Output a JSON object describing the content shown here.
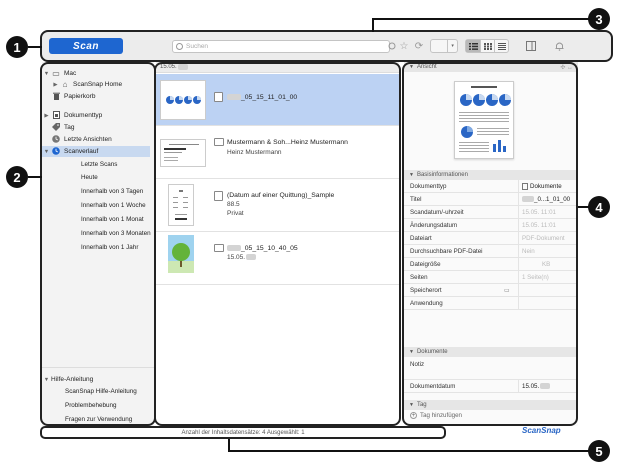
{
  "toolbar": {
    "scan_label": "Scan",
    "search_placeholder": "Suchen"
  },
  "sidebar": {
    "tree": [
      {
        "label": "Mac",
        "twisty": "▼",
        "icon": "▭"
      },
      {
        "label": "ScanSnap Home",
        "twisty": "▶",
        "icon": "⌂"
      },
      {
        "label": "Papierkorb",
        "twisty": "",
        "icon": "🗑"
      },
      {
        "label": "Dokumenttyp",
        "twisty": "▶",
        "icon": "▤"
      },
      {
        "label": "Tag",
        "twisty": "",
        "icon": "◆"
      },
      {
        "label": "Letzte Ansichten",
        "twisty": "",
        "icon": "◷"
      },
      {
        "label": "Scanverlauf",
        "twisty": "▼",
        "icon": "◔"
      }
    ],
    "history": [
      "Letzte Scans",
      "Heute",
      "Innerhalb von 3 Tagen",
      "Innerhalb von 1 Woche",
      "Innerhalb von 1 Monat",
      "Innerhalb von 3 Monaten",
      "Innerhalb von 1 Jahr"
    ],
    "help_header": "Hilfe-Anleitung",
    "help_items": [
      "ScanSnap Hilfe-Anleitung",
      "Problembehebung",
      "Fragen zur Verwendung"
    ]
  },
  "list": {
    "date_header": "15.05.",
    "items": [
      {
        "title": "_05_15_11_01_00",
        "sub1": "",
        "sub2": ""
      },
      {
        "title": "Mustermann & Soh...Heinz Mustermann",
        "sub1": "Heinz Mustermann",
        "sub2": ""
      },
      {
        "title": "(Datum auf einer Quittung)_Sample",
        "sub1": "88.5",
        "sub2": "Privat"
      },
      {
        "title": "_05_15_10_40_05",
        "sub1": "15.05.",
        "sub2": ""
      }
    ]
  },
  "panel": {
    "view_header": "Ansicht",
    "basis_header": "Basisinformationen",
    "rows": [
      {
        "k": "Dokumenttyp",
        "v": "Dokumente"
      },
      {
        "k": "Titel",
        "v": "_0...1_01_00"
      },
      {
        "k": "Scandatum/-uhrzeit",
        "v": "15.05.     11:01"
      },
      {
        "k": "Änderungsdatum",
        "v": "15.05.     11:01"
      },
      {
        "k": "Dateiart",
        "v": "PDF-Dokument"
      },
      {
        "k": "Durchsuchbare PDF-Datei",
        "v": "Nein"
      },
      {
        "k": "Dateigröße",
        "v": "KB"
      },
      {
        "k": "Seiten",
        "v": "1 Seite(n)"
      },
      {
        "k": "Speicherort",
        "v": ""
      },
      {
        "k": "Anwendung",
        "v": ""
      }
    ],
    "docs_header": "Dokumente",
    "notiz_label": "Notiz",
    "dokdatum_label": "Dokumentdatum",
    "dokdatum_value": "15.05.",
    "tag_header": "Tag",
    "tag_add": "Tag hinzufügen"
  },
  "status": {
    "text": "Anzahl der Inhaltsdatensätze: 4  Ausgewählt: 1",
    "brand": "ScanSnap"
  },
  "callouts": [
    "1",
    "2",
    "3",
    "4",
    "5"
  ],
  "colors": {
    "accent": "#1e66d0",
    "selection": "#bcd2f3"
  }
}
